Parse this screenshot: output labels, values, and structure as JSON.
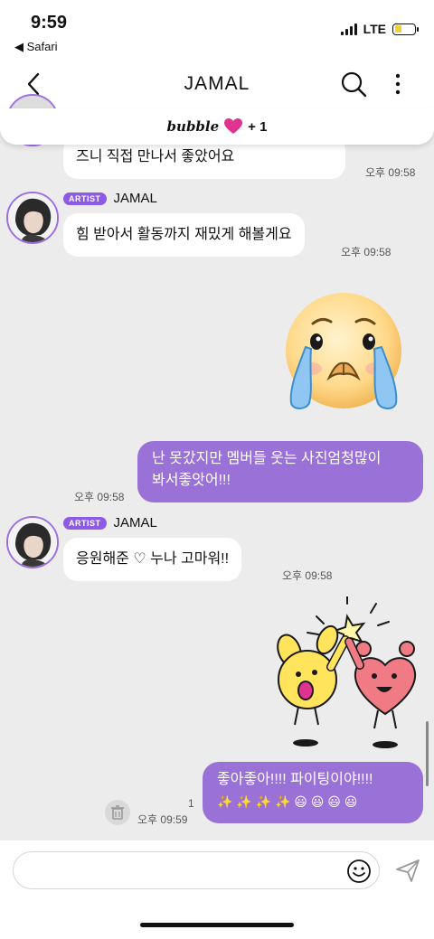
{
  "status_bar": {
    "time": "9:59",
    "back_app": "◀ Safari",
    "network": "LTE",
    "battery_level": 0.35
  },
  "nav": {
    "title": "JAMAL"
  },
  "bubble_banner": {
    "word": "bubble",
    "plus": "+ 1"
  },
  "messages": [
    {
      "type": "incoming",
      "text": "즈니 직접 만나서 좋았어요",
      "time": "오후 09:58"
    },
    {
      "type": "incoming",
      "artist_badge": "ARTIST",
      "artist_name": "JAMAL",
      "text": "힘 받아서 활동까지 재밌게 해볼게요",
      "time": "오후 09:58"
    },
    {
      "type": "outgoing-sticker",
      "sticker": "crying-emoji-sticker"
    },
    {
      "type": "outgoing",
      "line1": "난 못갔지만 멤버들 웃는 사진엄청많이",
      "line2": "봐서좋앗어!!!",
      "time": "오후 09:58"
    },
    {
      "type": "incoming",
      "artist_badge": "ARTIST",
      "artist_name": "JAMAL",
      "text": "응원해준 ♡ 누나 고마워!!",
      "time": "오후 09:58"
    },
    {
      "type": "outgoing-sticker",
      "sticker": "high-five-sticker"
    },
    {
      "type": "outgoing",
      "line1": "좋아좋아!!!! 파이팅이야!!!!",
      "line2": "✨ ✨ ✨ ✨ 😃 😃 😃 😃",
      "time": "오후 09:59",
      "unread": "1"
    }
  ],
  "input": {
    "placeholder": ""
  },
  "colors": {
    "accent": "#9a71d6",
    "artist_badge": "#8d5ae6",
    "heart": "#e0338f"
  }
}
